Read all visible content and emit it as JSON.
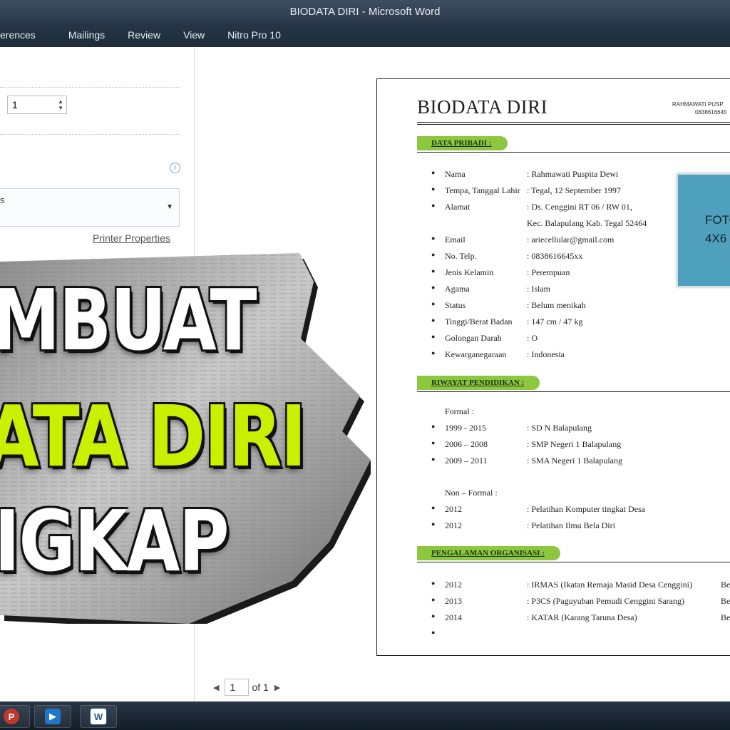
{
  "window": {
    "title": "BIODATA DIRI  -  Microsoft Word"
  },
  "ribbon": {
    "tabs": [
      "erences",
      "Mailings",
      "Review",
      "View",
      "Nitro Pro 10"
    ]
  },
  "print_panel": {
    "copies_value": "1",
    "printer_partial": "s",
    "printer_properties": "Printer Properties"
  },
  "document": {
    "title": "BIODATA DIRI",
    "header_right": [
      "RAHMAWATI PUSP",
      "0838616645"
    ],
    "sections": {
      "personal": "DATA PRIBADI :",
      "education": "RIWAYAT PENDIDIKAN :",
      "organization": "PENGALAMAN ORGANISASI :"
    },
    "personal_rows": [
      {
        "key": "Nama",
        "value": ": Rahmawati Puspita Dewi"
      },
      {
        "key": "Tempa, Tanggal Lahir",
        "value": ": Tegal, 12 September 1997"
      },
      {
        "key": "Alamat",
        "value": ": Ds. Cenggini RT 06 / RW 01,"
      },
      {
        "key": "",
        "value": "  Kec. Balapulang Kab. Tegal 52464"
      },
      {
        "key": "Email",
        "value": ": ariecellular@gmail.com"
      },
      {
        "key": "No. Telp.",
        "value": ": 0838616645xx"
      },
      {
        "key": "Jenis Kelamin",
        "value": ": Perempuan"
      },
      {
        "key": "Agama",
        "value": ": Islam"
      },
      {
        "key": "Status",
        "value": ": Belum menikah"
      },
      {
        "key": "Tinggi/Berat Badan",
        "value": ": 147 cm / 47 kg"
      },
      {
        "key": "Golongan Darah",
        "value": ": O"
      },
      {
        "key": "Kewarganegaraan",
        "value": ": Indonesia"
      }
    ],
    "photo": [
      "FOTO",
      "4X6"
    ],
    "formal_label": "Formal :",
    "formal": [
      {
        "key": "1999 - 2015",
        "value": ": SD N Balapulang"
      },
      {
        "key": "2006 – 2008",
        "value": ": SMP Negeri 1 Balapulang"
      },
      {
        "key": "2009 – 2011",
        "value": ": SMA Negeri 1 Balapulang"
      }
    ],
    "nonformal_label": "Non – Formal :",
    "nonformal": [
      {
        "key": "2012",
        "value": ": Pelatihan Komputer tingkat Desa"
      },
      {
        "key": "2012",
        "value": ": Pelatihan Ilmu Bela Diri"
      }
    ],
    "organization_rows": [
      {
        "key": "2012",
        "value": ": IRMAS (Ikatan Remaja Masid Desa Cenggini)",
        "extra": "Be"
      },
      {
        "key": "2013",
        "value": ": P3CS (Paguyuban Pemudi Cenggini Sarang)",
        "extra": "Be"
      },
      {
        "key": "2014",
        "value": ": KATAR (Karang Taruna Desa)",
        "extra": "Be"
      },
      {
        "key": "",
        "value": "",
        "extra": ""
      }
    ]
  },
  "pager": {
    "current": "1",
    "of": "of 1"
  },
  "banner": {
    "line1": "MBUAT",
    "line2": "ATA DIRI",
    "line3": "IGKAP"
  },
  "taskbar": {
    "apps": [
      "pdf-app",
      "media-player",
      "word"
    ]
  }
}
